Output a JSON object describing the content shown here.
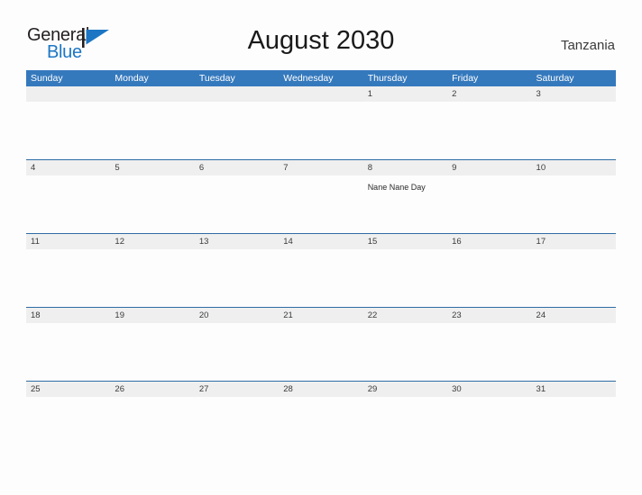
{
  "brand": {
    "name_part1": "General",
    "name_part2": "Blue",
    "flag_icon": "flag-triangle-icon",
    "flag_color": "#1c76c4",
    "text_color": "#231f20"
  },
  "header": {
    "title": "August 2030",
    "country": "Tanzania"
  },
  "theme": {
    "header_blue": "#3579bd",
    "row_border_blue": "#2e6da4",
    "band_gray": "#efefef",
    "page_background": "#fdfdfd"
  },
  "calendar": {
    "weekdays": [
      "Sunday",
      "Monday",
      "Tuesday",
      "Wednesday",
      "Thursday",
      "Friday",
      "Saturday"
    ],
    "weeks": [
      {
        "days": [
          {
            "date": "",
            "event": ""
          },
          {
            "date": "",
            "event": ""
          },
          {
            "date": "",
            "event": ""
          },
          {
            "date": "",
            "event": ""
          },
          {
            "date": "1",
            "event": ""
          },
          {
            "date": "2",
            "event": ""
          },
          {
            "date": "3",
            "event": ""
          }
        ]
      },
      {
        "days": [
          {
            "date": "4",
            "event": ""
          },
          {
            "date": "5",
            "event": ""
          },
          {
            "date": "6",
            "event": ""
          },
          {
            "date": "7",
            "event": ""
          },
          {
            "date": "8",
            "event": "Nane Nane Day"
          },
          {
            "date": "9",
            "event": ""
          },
          {
            "date": "10",
            "event": ""
          }
        ]
      },
      {
        "days": [
          {
            "date": "11",
            "event": ""
          },
          {
            "date": "12",
            "event": ""
          },
          {
            "date": "13",
            "event": ""
          },
          {
            "date": "14",
            "event": ""
          },
          {
            "date": "15",
            "event": ""
          },
          {
            "date": "16",
            "event": ""
          },
          {
            "date": "17",
            "event": ""
          }
        ]
      },
      {
        "days": [
          {
            "date": "18",
            "event": ""
          },
          {
            "date": "19",
            "event": ""
          },
          {
            "date": "20",
            "event": ""
          },
          {
            "date": "21",
            "event": ""
          },
          {
            "date": "22",
            "event": ""
          },
          {
            "date": "23",
            "event": ""
          },
          {
            "date": "24",
            "event": ""
          }
        ]
      },
      {
        "days": [
          {
            "date": "25",
            "event": ""
          },
          {
            "date": "26",
            "event": ""
          },
          {
            "date": "27",
            "event": ""
          },
          {
            "date": "28",
            "event": ""
          },
          {
            "date": "29",
            "event": ""
          },
          {
            "date": "30",
            "event": ""
          },
          {
            "date": "31",
            "event": ""
          }
        ]
      }
    ]
  }
}
